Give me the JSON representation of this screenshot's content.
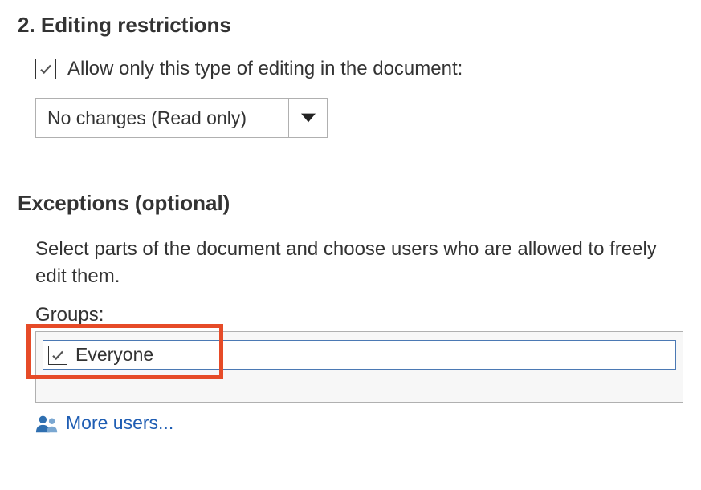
{
  "editing": {
    "section_title": "2. Editing restrictions",
    "allow_label": "Allow only this type of editing in the document:",
    "dropdown_value": "No changes (Read only)"
  },
  "exceptions": {
    "section_title": "Exceptions (optional)",
    "description": "Select parts of the document and choose users who are allowed to freely edit them.",
    "groups_label": "Groups:",
    "groups": [
      {
        "name": "Everyone",
        "checked": true
      }
    ],
    "more_users_label": "More users..."
  }
}
